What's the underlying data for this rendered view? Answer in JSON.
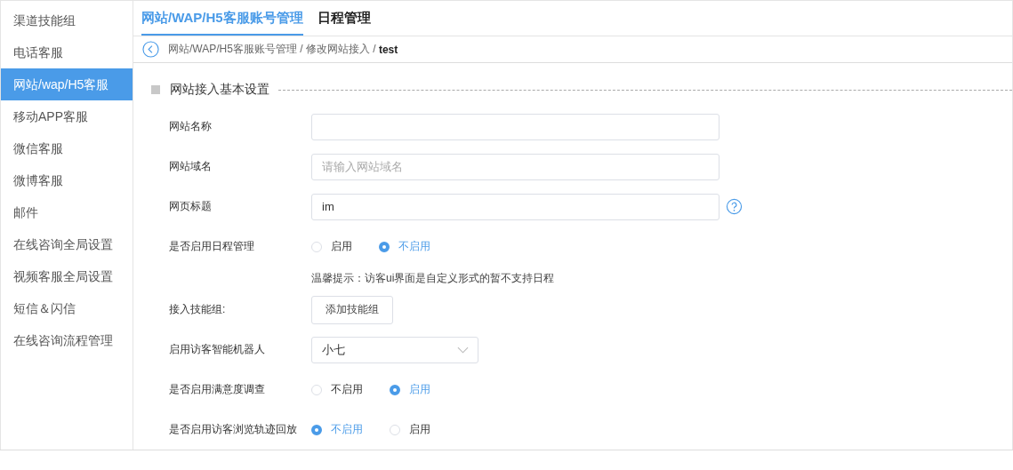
{
  "sidebar": {
    "items": [
      {
        "label": "渠道技能组",
        "selected": false
      },
      {
        "label": "电话客服",
        "selected": false
      },
      {
        "label": "网站/wap/H5客服",
        "selected": true
      },
      {
        "label": "移动APP客服",
        "selected": false
      },
      {
        "label": "微信客服",
        "selected": false
      },
      {
        "label": "微博客服",
        "selected": false
      },
      {
        "label": "邮件",
        "selected": false
      },
      {
        "label": "在线咨询全局设置",
        "selected": false
      },
      {
        "label": "视频客服全局设置",
        "selected": false
      },
      {
        "label": "短信＆闪信",
        "selected": false
      },
      {
        "label": "在线咨询流程管理",
        "selected": false
      }
    ]
  },
  "tabs": [
    {
      "label": "网站/WAP/H5客服账号管理",
      "selected": true
    },
    {
      "label": "日程管理",
      "selected": false
    }
  ],
  "breadcrumb": {
    "path": "网站/WAP/H5客服账号管理 / 修改网站接入 / ",
    "current": "test"
  },
  "section": {
    "title": "网站接入基本设置"
  },
  "form": [
    {
      "kind": "input",
      "label": "网站名称"
    },
    {
      "kind": "input",
      "label": "网站域名",
      "placeholder": "请输入网站域名"
    },
    {
      "kind": "input",
      "label": "网页标题",
      "value": "im",
      "help": true
    },
    {
      "kind": "radio",
      "label": "是否启用日程管理",
      "options": [
        {
          "label": "启用",
          "selected": false
        },
        {
          "label": "不启用",
          "selected": true
        }
      ]
    },
    {
      "kind": "hint",
      "text": "温馨提示：访客ui界面是自定义形式的暂不支持日程"
    },
    {
      "kind": "button",
      "label": "接入技能组:",
      "button": "添加技能组"
    },
    {
      "kind": "select",
      "label": "启用访客智能机器人",
      "value": "小七"
    },
    {
      "kind": "radio",
      "label": "是否启用满意度调查",
      "options": [
        {
          "label": "不启用",
          "selected": false
        },
        {
          "label": "启用",
          "selected": true
        }
      ]
    },
    {
      "kind": "radio",
      "label": "是否启用访客浏览轨迹回放",
      "options": [
        {
          "label": "不启用",
          "selected": true
        },
        {
          "label": "启用",
          "selected": false
        }
      ]
    }
  ]
}
